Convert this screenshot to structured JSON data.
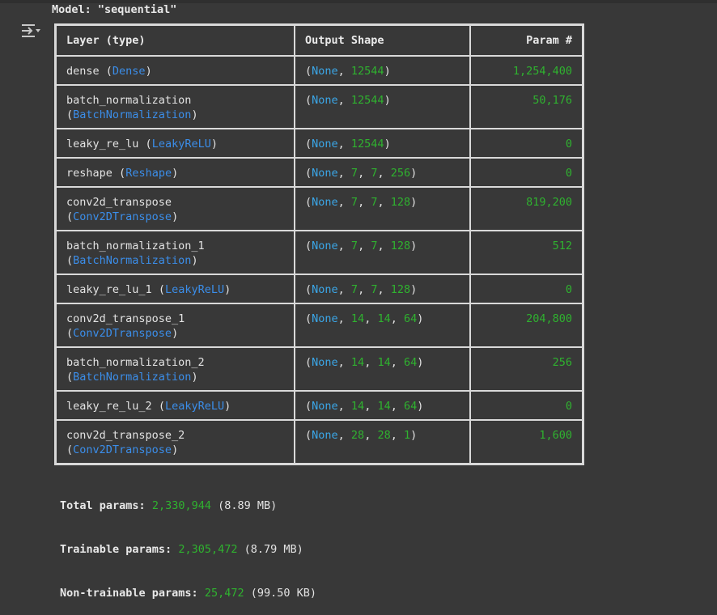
{
  "model_line": "Model: \"sequential\"",
  "headers": {
    "layer": "Layer (type)",
    "shape": "Output Shape",
    "param": "Param #"
  },
  "rows": [
    {
      "name": "dense",
      "type": "Dense",
      "shape": [
        "None",
        "12544"
      ],
      "params": "1,254,400",
      "wrap": false
    },
    {
      "name": "batch_normalization",
      "type": "BatchNormalization",
      "shape": [
        "None",
        "12544"
      ],
      "params": "50,176",
      "wrap": true
    },
    {
      "name": "leaky_re_lu",
      "type": "LeakyReLU",
      "shape": [
        "None",
        "12544"
      ],
      "params": "0",
      "wrap": false
    },
    {
      "name": "reshape",
      "type": "Reshape",
      "shape": [
        "None",
        "7",
        "7",
        "256"
      ],
      "params": "0",
      "wrap": false
    },
    {
      "name": "conv2d_transpose",
      "type": "Conv2DTranspose",
      "shape": [
        "None",
        "7",
        "7",
        "128"
      ],
      "params": "819,200",
      "wrap": true
    },
    {
      "name": "batch_normalization_1",
      "type": "BatchNormalization",
      "shape": [
        "None",
        "7",
        "7",
        "128"
      ],
      "params": "512",
      "wrap": true
    },
    {
      "name": "leaky_re_lu_1",
      "type": "LeakyReLU",
      "shape": [
        "None",
        "7",
        "7",
        "128"
      ],
      "params": "0",
      "wrap": false
    },
    {
      "name": "conv2d_transpose_1",
      "type": "Conv2DTranspose",
      "shape": [
        "None",
        "14",
        "14",
        "64"
      ],
      "params": "204,800",
      "wrap": true
    },
    {
      "name": "batch_normalization_2",
      "type": "BatchNormalization",
      "shape": [
        "None",
        "14",
        "14",
        "64"
      ],
      "params": "256",
      "wrap": true
    },
    {
      "name": "leaky_re_lu_2",
      "type": "LeakyReLU",
      "shape": [
        "None",
        "14",
        "14",
        "64"
      ],
      "params": "0",
      "wrap": false
    },
    {
      "name": "conv2d_transpose_2",
      "type": "Conv2DTranspose",
      "shape": [
        "None",
        "28",
        "28",
        "1"
      ],
      "params": "1,600",
      "wrap": true
    }
  ],
  "totals": {
    "total_label": "Total params:",
    "total_value": "2,330,944",
    "total_size": "(8.89 MB)",
    "trainable_label": "Trainable params:",
    "trainable_value": "2,305,472",
    "trainable_size": "(8.79 MB)",
    "nontrainable_label": "Non-trainable params:",
    "nontrainable_value": "25,472",
    "nontrainable_size": "(99.50 KB)"
  },
  "icons": {
    "output_toggle": "output-actions-icon"
  },
  "colors": {
    "background": "#383838",
    "border": "#d9d9d9",
    "class_name": "#3b8eea",
    "none_keyword": "#3ba7e8",
    "number": "#2fb22f"
  }
}
